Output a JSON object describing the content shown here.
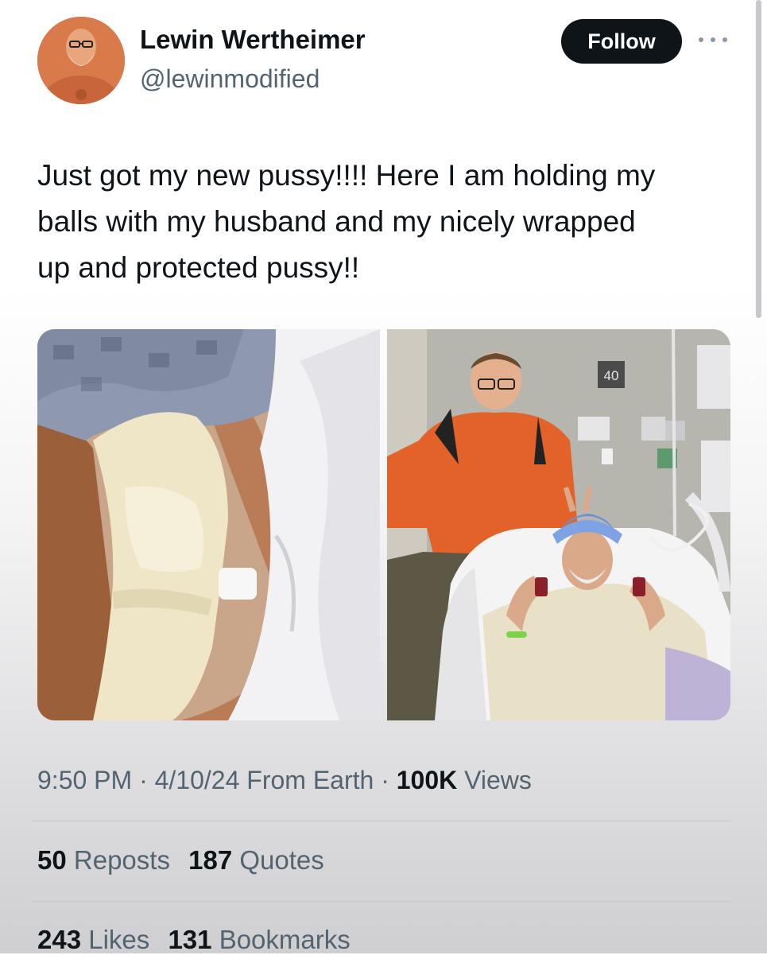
{
  "author": {
    "display_name": "Lewin Wertheimer",
    "handle": "@lewinmodified",
    "avatar_icon": "profile-photo"
  },
  "header": {
    "follow_label": "Follow",
    "more_icon": "more-horizontal-icon"
  },
  "tweet": {
    "lines": [
      "Just got my new pussy!!!! Here I am holding my",
      "balls with my husband and my nicely wrapped",
      "up and protected pussy!!"
    ]
  },
  "media": {
    "photo_1": "hospital bandage photo",
    "photo_2": "hospital bed group photo",
    "room_number": "40"
  },
  "meta": {
    "time": "9:50 PM",
    "sep1": "·",
    "date": "4/10/24",
    "source": "From Earth",
    "sep2": "·",
    "views_count": "100K",
    "views_label": "Views"
  },
  "stats": {
    "reposts_count": "50",
    "reposts_label": "Reposts",
    "quotes_count": "187",
    "quotes_label": "Quotes",
    "likes_count": "243",
    "likes_label": "Likes",
    "bookmarks_count": "131",
    "bookmarks_label": "Bookmarks"
  },
  "colors": {
    "text_primary": "#0f1419",
    "text_secondary": "#536471",
    "button_bg": "#0f1419",
    "button_text": "#ffffff"
  }
}
